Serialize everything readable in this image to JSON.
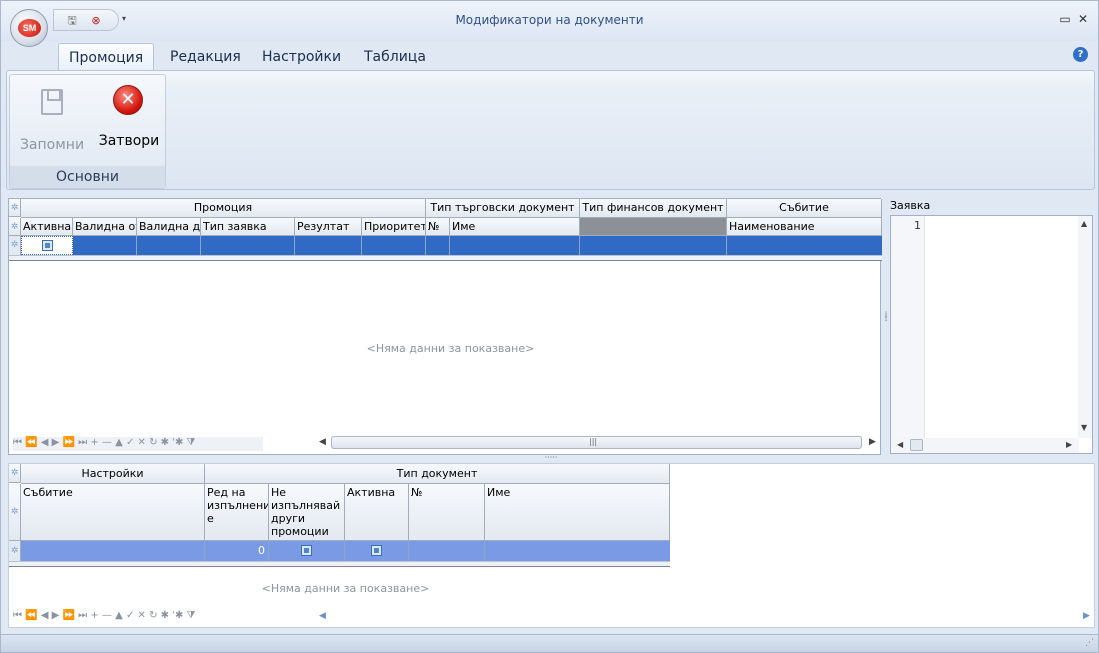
{
  "window": {
    "title": "Модификатори на документи",
    "app_logo": "SM"
  },
  "ribbon_tabs": [
    "Промоция",
    "Редакция",
    "Настройки",
    "Таблица"
  ],
  "ribbon_group": {
    "label": "Основни",
    "save_label": "Запомни",
    "close_label": "Затвори"
  },
  "top_grid": {
    "band_headers": [
      "Промоция",
      "Тип търговски документ",
      "Тип финансов документ",
      "Събитие"
    ],
    "columns": [
      "Активна",
      "Валидна от",
      "Валидна до",
      "Тип заявка",
      "Резултат",
      "Приоритет",
      "№",
      "Име",
      "",
      "Наименование"
    ],
    "no_data": "<Няма данни за показване>"
  },
  "request_panel": {
    "label": "Заявка",
    "line_number": "1"
  },
  "bottom_grid": {
    "band_headers": [
      "Настройки",
      "Тип документ"
    ],
    "columns": [
      "Събитие",
      "Ред на изпълнени е",
      "Не изпълнявай други промоции",
      "Активна",
      "№",
      "Име"
    ],
    "new_row_order_value": "0",
    "no_data": "<Няма данни за показване>"
  },
  "navigator_glyphs": "⏮ ⏪ ◀ ▶ ⏩ ⏭ + — ▲ ✓ ✕ ↻ ✱ '✱ ⧩",
  "colors": {
    "selection": "#316ac5",
    "bottom_selection": "#7b9ae6",
    "accent": "#2f4f8a"
  }
}
